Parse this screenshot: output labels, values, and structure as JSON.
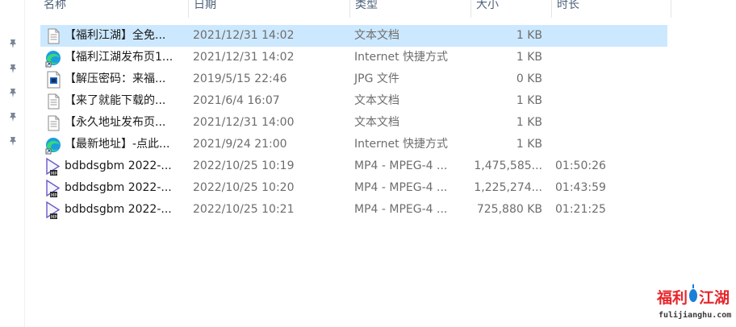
{
  "columns": {
    "name": "名称",
    "date": "日期",
    "type": "类型",
    "size": "大小",
    "duration": "时长"
  },
  "quick_access_pins": 5,
  "files": [
    {
      "name": "【福利江湖】全免...",
      "date": "2021/12/31 14:02",
      "type": "文本文档",
      "size": "1 KB",
      "duration": "",
      "icon": "text-document-icon",
      "selected": true
    },
    {
      "name": "【福利江湖发布页1...",
      "date": "2021/12/31 14:02",
      "type": "Internet 快捷方式",
      "size": "1 KB",
      "duration": "",
      "icon": "edge-shortcut-icon",
      "selected": false
    },
    {
      "name": "【解压密码：来福...",
      "date": "2019/5/15 22:46",
      "type": "JPG 文件",
      "size": "0 KB",
      "duration": "",
      "icon": "jpg-image-icon",
      "selected": false
    },
    {
      "name": "【来了就能下载的...",
      "date": "2021/6/4 16:07",
      "type": "文本文档",
      "size": "1 KB",
      "duration": "",
      "icon": "text-document-icon",
      "selected": false
    },
    {
      "name": "【永久地址发布页...",
      "date": "2021/12/31 14:00",
      "type": "文本文档",
      "size": "1 KB",
      "duration": "",
      "icon": "text-document-icon",
      "selected": false
    },
    {
      "name": "【最新地址】-点此...",
      "date": "2021/9/24 21:00",
      "type": "Internet 快捷方式",
      "size": "1 KB",
      "duration": "",
      "icon": "edge-shortcut-icon",
      "selected": false
    },
    {
      "name": "bdbdsgbm 2022-...",
      "date": "2022/10/25 10:19",
      "type": "MP4 - MPEG-4 ...",
      "size": "1,475,585...",
      "duration": "01:50:26",
      "icon": "video-file-icon",
      "selected": false
    },
    {
      "name": "bdbdsgbm 2022-...",
      "date": "2022/10/25 10:20",
      "type": "MP4 - MPEG-4 ...",
      "size": "1,225,274...",
      "duration": "01:43:59",
      "icon": "video-file-icon",
      "selected": false
    },
    {
      "name": "bdbdsgbm 2022-...",
      "date": "2022/10/25 10:21",
      "type": "MP4 - MPEG-4 ...",
      "size": "725,880 KB",
      "duration": "01:21:25",
      "icon": "video-file-icon",
      "selected": false
    }
  ],
  "watermark": {
    "title": "福利江湖",
    "url": "fulijianghu.com"
  },
  "colors": {
    "selection": "#cce8ff",
    "header_text": "#4c607a",
    "meta_text": "#6d6d6d",
    "watermark_red": "#e8262b",
    "watermark_blue": "#1a7fd6"
  }
}
